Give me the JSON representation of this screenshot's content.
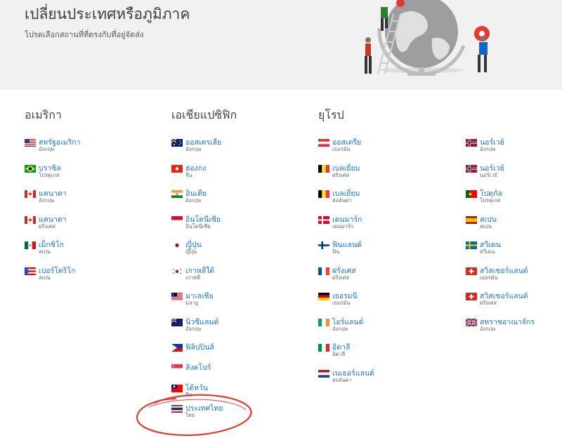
{
  "header": {
    "title": "เปลี่ยนประเทศหรือภูมิภาค",
    "subtitle": "โปรดเลือกสถานที่ที่ตรงกับที่อยู่จัดส่ง"
  },
  "columns": [
    {
      "title": "อเมริกา",
      "items": [
        {
          "name": "สหรัฐอเมริกา",
          "lang": "อังกฤษ",
          "flag": "us-flag-icon"
        },
        {
          "name": "บราซิล",
          "lang": "โปรตุเกส",
          "flag": "brazil-flag-icon"
        },
        {
          "name": "แคนาดา",
          "lang": "อังกฤษ",
          "flag": "canada-flag-icon"
        },
        {
          "name": "แคนาดา",
          "lang": "ฝรั่งเศส",
          "flag": "canada-flag-icon"
        },
        {
          "name": "เม็กซิโก",
          "lang": "สเปน",
          "flag": "mexico-flag-icon"
        },
        {
          "name": "เปอร์โตริโก",
          "lang": "สเปน",
          "flag": "puerto-rico-flag-icon"
        }
      ]
    },
    {
      "title": "เอเชียแปซิฟิก",
      "items": [
        {
          "name": "ออสเตรเลีย",
          "lang": "อังกฤษ",
          "flag": "australia-flag-icon"
        },
        {
          "name": "ฮ่องกง",
          "lang": "จีน",
          "flag": "hong-kong-flag-icon"
        },
        {
          "name": "อินเดีย",
          "lang": "อังกฤษ",
          "flag": "india-flag-icon"
        },
        {
          "name": "อินโดนีเซีย",
          "lang": "อินโดนีเซีย",
          "flag": "indonesia-flag-icon"
        },
        {
          "name": "ญี่ปุ่น",
          "lang": "ญี่ปุ่น",
          "flag": "japan-flag-icon"
        },
        {
          "name": "เกาหลีใต้",
          "lang": "เกาหลี",
          "flag": "south-korea-flag-icon"
        },
        {
          "name": "มาเลเซีย",
          "lang": "มลายู",
          "flag": "malaysia-flag-icon"
        },
        {
          "name": "นิวซีแลนด์",
          "lang": "อังกฤษ",
          "flag": "new-zealand-flag-icon"
        },
        {
          "name": "ฟิลิปปินส์",
          "lang": "",
          "flag": "philippines-flag-icon"
        },
        {
          "name": "สิงคโปร์",
          "lang": "",
          "flag": "singapore-flag-icon"
        },
        {
          "name": "ไต้หวัน",
          "lang": "จีน",
          "flag": "taiwan-flag-icon"
        },
        {
          "name": "ประเทศไทย",
          "lang": "ไทย",
          "flag": "thailand-flag-icon"
        }
      ]
    },
    {
      "title": "ยุโรป",
      "items": [
        {
          "name": "ออสเตรีย",
          "lang": "เยอรมัน",
          "flag": "austria-flag-icon"
        },
        {
          "name": "เบลเยี่ยม",
          "lang": "ฝรั่งเศส",
          "flag": "belgium-flag-icon"
        },
        {
          "name": "เบลเยี่ยม",
          "lang": "ฮอลันดา",
          "flag": "belgium-flag-icon"
        },
        {
          "name": "เดนมาร์ก",
          "lang": "เดนมาร์ก",
          "flag": "denmark-flag-icon"
        },
        {
          "name": "ฟินแลนด์",
          "lang": "ฟิน",
          "flag": "finland-flag-icon"
        },
        {
          "name": "ฝรั่งเศส",
          "lang": "ฝรั่งเศส",
          "flag": "france-flag-icon"
        },
        {
          "name": "เยอรมนี",
          "lang": "เยอรมัน",
          "flag": "germany-flag-icon"
        },
        {
          "name": "ไอร์แลนด์",
          "lang": "อังกฤษ",
          "flag": "ireland-flag-icon"
        },
        {
          "name": "อิตาลี",
          "lang": "อิตาลี",
          "flag": "italy-flag-icon"
        },
        {
          "name": "เนเธอร์แลนด์",
          "lang": "ฮอลันดา",
          "flag": "netherlands-flag-icon"
        }
      ]
    },
    {
      "title": "",
      "items": [
        {
          "name": "นอร์เวย์",
          "lang": "อังกฤษ",
          "flag": "norway-flag-icon"
        },
        {
          "name": "นอร์เวย์",
          "lang": "นอร์เวย์",
          "flag": "norway-flag-icon"
        },
        {
          "name": "โปตุกัล",
          "lang": "โปรตุเกส",
          "flag": "portugal-flag-icon"
        },
        {
          "name": "สเปน",
          "lang": "สเปน",
          "flag": "spain-flag-icon"
        },
        {
          "name": "สวีเดน",
          "lang": "สวีเดน",
          "flag": "sweden-flag-icon"
        },
        {
          "name": "สวิสเซอร์แลนด์",
          "lang": "เยอรมัน",
          "flag": "switzerland-flag-icon"
        },
        {
          "name": "สวิสเซอร์แลนด์",
          "lang": "ฝรั่งเศส",
          "flag": "switzerland-flag-icon"
        },
        {
          "name": "สหราชอาณาจักร",
          "lang": "อังกฤษ",
          "flag": "uk-flag-icon"
        }
      ]
    }
  ],
  "colors": {
    "link": "#1a73e8",
    "hero_bg": "#f1f1f1",
    "annotation": "#e53935"
  }
}
